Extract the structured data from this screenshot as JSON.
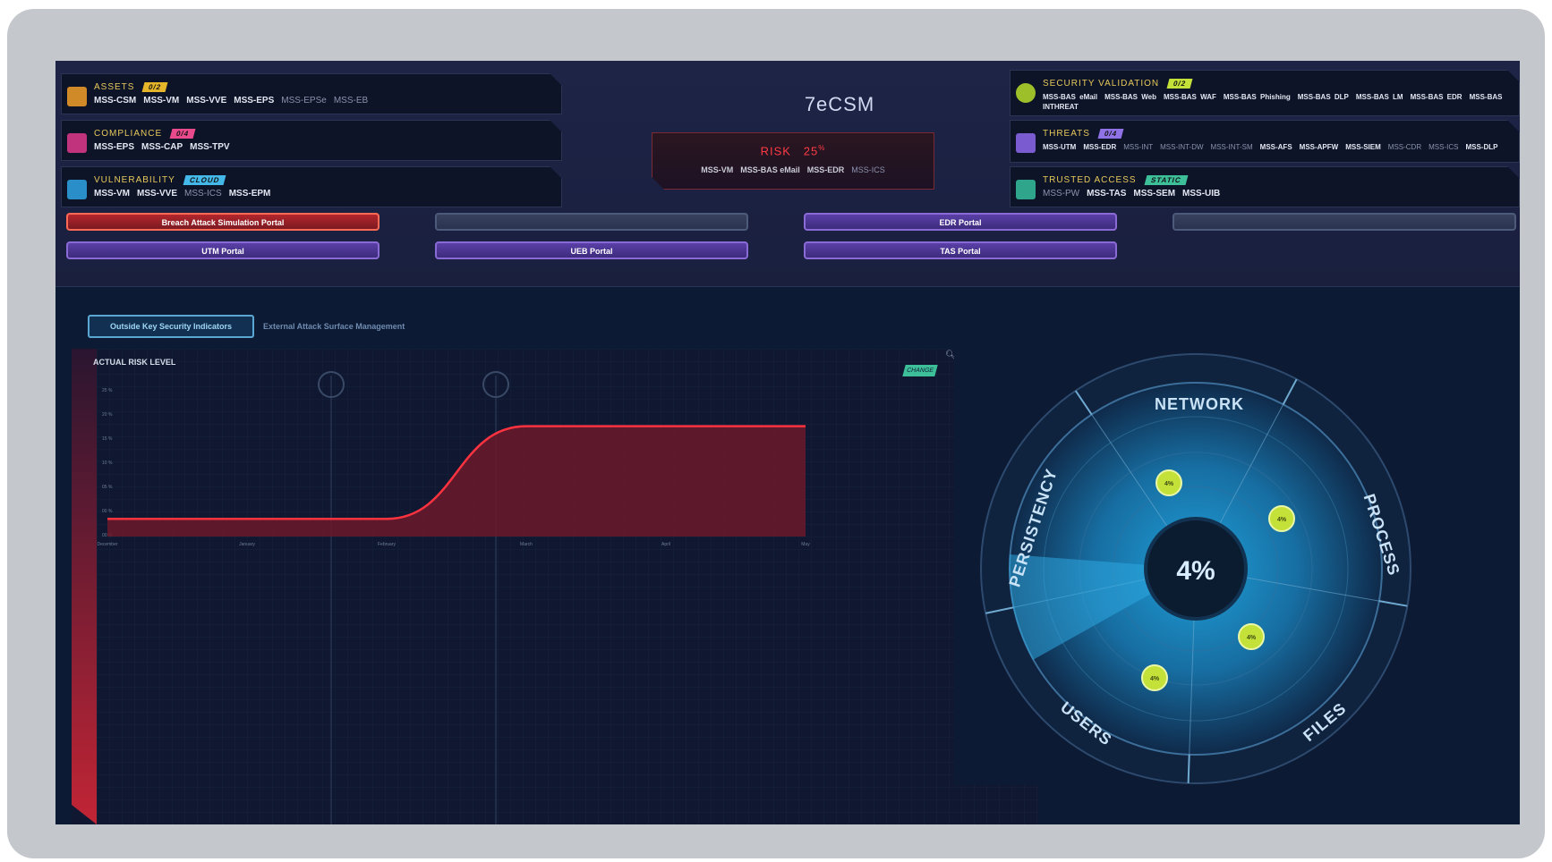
{
  "panels": {
    "assets": {
      "title": "ASSETS",
      "badge": "0/2",
      "items": [
        "MSS-CSM",
        "MSS-VM",
        "MSS-VVE",
        "MSS-EPS",
        "MSS-EPSe",
        "MSS-EB"
      ]
    },
    "compliance": {
      "title": "COMPLIANCE",
      "badge": "0/4",
      "items": [
        "MSS-EPS",
        "MSS-CAP",
        "MSS-TPV"
      ]
    },
    "vulnerability": {
      "title": "VULNERABILITY",
      "badge": "CLOUD",
      "items": [
        "MSS-VM",
        "MSS-VVE",
        "MSS-ICS",
        "MSS-EPM"
      ]
    },
    "security_validation": {
      "title": "SECURITY VALIDATION",
      "badge": "0/2",
      "items": [
        "MSS-BAS eMail",
        "MSS-BAS Web",
        "MSS-BAS WAF",
        "MSS-BAS Phishing",
        "MSS-BAS DLP",
        "MSS-BAS LM",
        "MSS-BAS EDR",
        "MSS-BAS INTHREAT"
      ]
    },
    "threats": {
      "title": "THREATS",
      "badge": "0/4",
      "items": [
        "MSS-UTM",
        "MSS-EDR",
        "MSS-INT",
        "MSS-INT-DW",
        "MSS-INT-SM",
        "MSS-AFS",
        "MSS-APFW",
        "MSS-SIEM",
        "MSS-CDR",
        "MSS-ICS",
        "MSS-DLP"
      ]
    },
    "trusted_access": {
      "title": "TRUSTED ACCESS",
      "badge": "STATIC",
      "items": [
        "MSS-PW",
        "MSS-TAS",
        "MSS-SEM",
        "MSS-UIB"
      ]
    }
  },
  "center": {
    "title": "7eCSM",
    "risk_label": "RISK",
    "risk_value": "25",
    "risk_unit": "%",
    "items": [
      "MSS-VM",
      "MSS-BAS eMail",
      "MSS-EDR",
      "MSS-ICS"
    ]
  },
  "portals": {
    "breach": "Breach Attack Simulation Portal",
    "edr": "EDR Portal",
    "utm": "UTM Portal",
    "ueb": "UEB Portal",
    "tas": "TAS Portal"
  },
  "tabs": {
    "active": "Outside Key Security Indicators",
    "inactive": "External Attack Surface Management"
  },
  "chart": {
    "title": "ACTUAL RISK LEVEL",
    "badge": "CHANGE"
  },
  "chart_data": {
    "type": "area",
    "title": "ACTUAL RISK LEVEL",
    "x": [
      "December",
      "January",
      "February",
      "March",
      "April",
      "May"
    ],
    "values": [
      4,
      4,
      4,
      25,
      25,
      25
    ],
    "y_ticks": [
      "25 %",
      "20 %",
      "15 %",
      "10 %",
      "05 %",
      "00 %",
      "00 %"
    ],
    "ylim": [
      0,
      30
    ],
    "series_color": "#ff3340",
    "fill_color": "#6b1a2a"
  },
  "radar": {
    "center_value": "4%",
    "segments": [
      "NETWORK",
      "PROCESS",
      "FILES",
      "USERS",
      "PERSISTENCY"
    ],
    "dots": [
      "4%",
      "4%",
      "4%",
      "4%"
    ]
  },
  "colors": {
    "accent_yellow": "#e6c95a",
    "accent_green": "#c4e13a",
    "risk_red": "#ff3a46",
    "radar_blue": "#1c8cc8"
  }
}
